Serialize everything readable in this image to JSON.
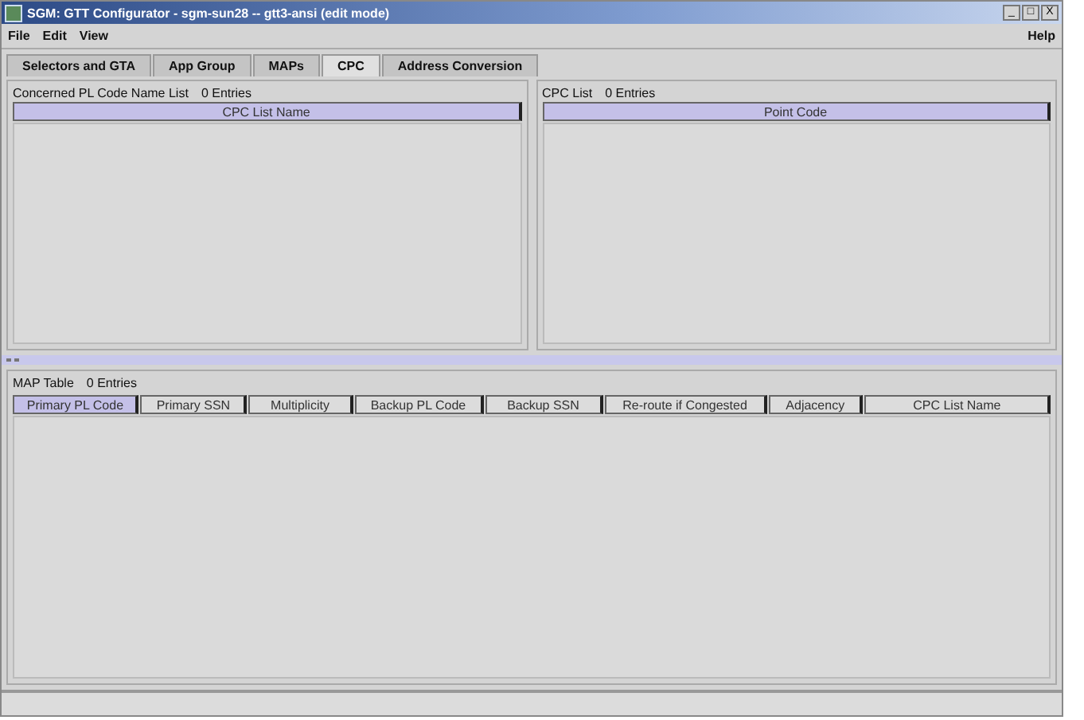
{
  "window": {
    "title": "SGM: GTT Configurator - sgm-sun28 -- gtt3-ansi (edit mode)",
    "controls": [
      "_",
      "□",
      "X"
    ]
  },
  "menu": [
    {
      "label": "File"
    },
    {
      "label": "Edit"
    },
    {
      "label": "View"
    }
  ],
  "help_menu": {
    "label": "Help"
  },
  "tabs": [
    {
      "label": "Selectors and GTA",
      "selected": false
    },
    {
      "label": "App Group",
      "selected": false
    },
    {
      "label": "MAPs",
      "selected": false
    },
    {
      "label": "CPC",
      "selected": true
    },
    {
      "label": "Address Conversion",
      "selected": false
    }
  ],
  "left_panel": {
    "title": "Concerned PL Code Name List",
    "count": "0 Entries",
    "columns": [
      {
        "label": "CPC List Name",
        "selected": true
      }
    ]
  },
  "right_panel": {
    "title": "CPC List",
    "count": "0 Entries",
    "columns": [
      {
        "label": "Point Code",
        "selected": true
      }
    ]
  },
  "map_table": {
    "title": "MAP Table",
    "count": "0 Entries",
    "columns": [
      {
        "label": "Primary PL Code",
        "selected": true
      },
      {
        "label": "Primary SSN",
        "selected": false
      },
      {
        "label": "Multiplicity",
        "selected": false
      },
      {
        "label": "Backup PL Code",
        "selected": false
      },
      {
        "label": "Backup SSN",
        "selected": false
      },
      {
        "label": "Re-route if Congested",
        "selected": false
      },
      {
        "label": "Adjacency",
        "selected": false
      },
      {
        "label": "CPC List Name",
        "selected": false
      }
    ]
  }
}
